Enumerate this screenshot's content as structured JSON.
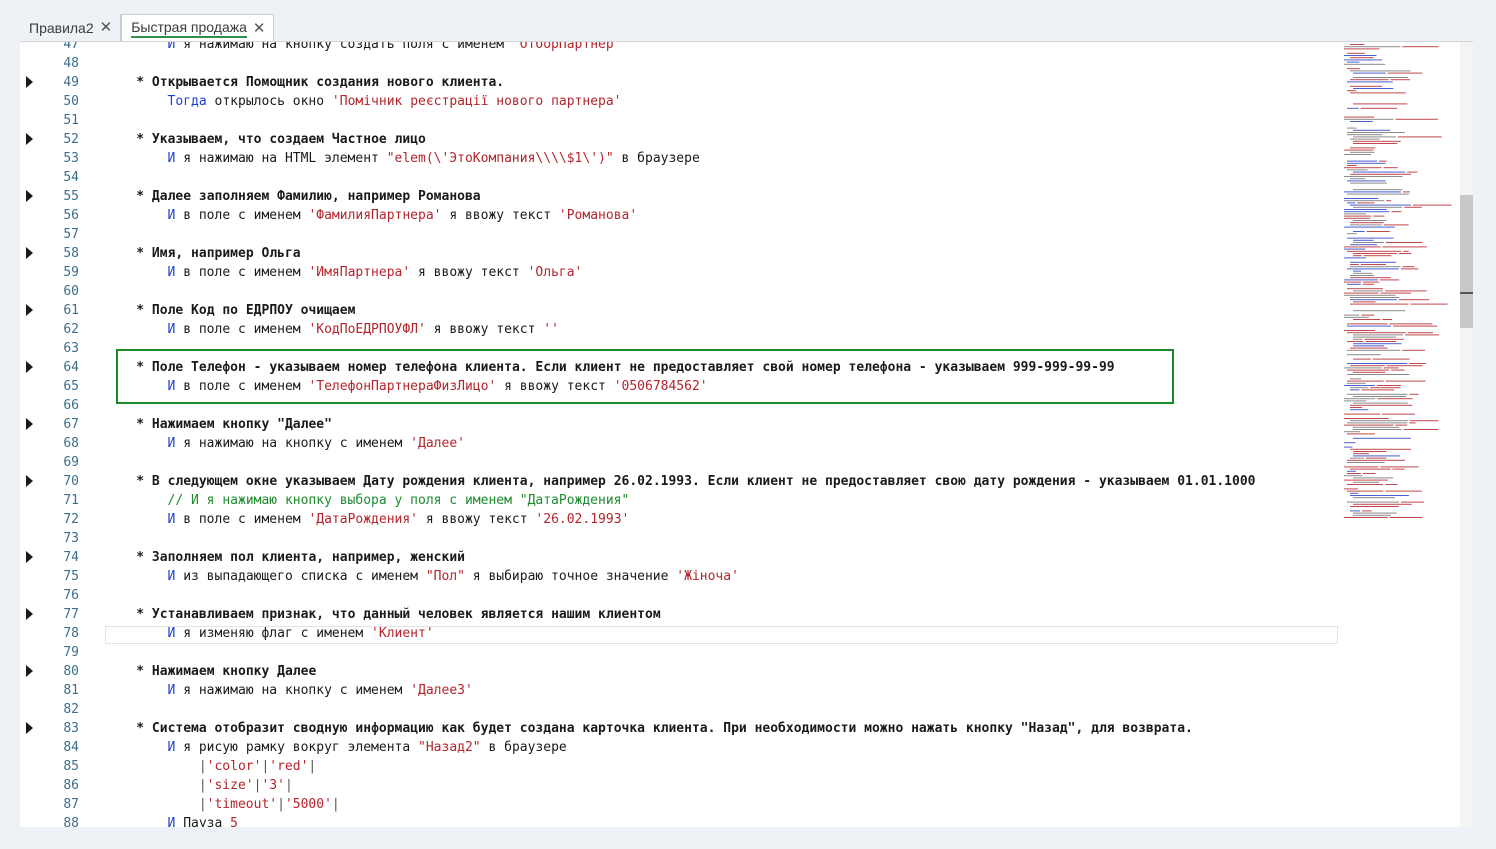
{
  "tabs": [
    {
      "label": "Правила2",
      "active": false
    },
    {
      "label": "Быстрая продажа",
      "active": true
    }
  ],
  "lines": [
    {
      "n": "47",
      "arrow": false,
      "indent": 8,
      "parts": [
        [
          "kw",
          "И"
        ],
        [
          "text",
          " я нажимаю на кнопку создать поля с именем "
        ],
        [
          "str",
          "\"ОтборПартнер\""
        ]
      ]
    },
    {
      "n": "48",
      "arrow": false,
      "indent": 0,
      "parts": []
    },
    {
      "n": "49",
      "arrow": true,
      "indent": 4,
      "parts": [
        [
          "step",
          "* Открывается Помощник создания нового клиента."
        ]
      ]
    },
    {
      "n": "50",
      "arrow": false,
      "indent": 8,
      "parts": [
        [
          "kw",
          "Тогда"
        ],
        [
          "text",
          " открылось окно "
        ],
        [
          "str",
          "'Помічник реєстрації нового партнера'"
        ]
      ]
    },
    {
      "n": "51",
      "arrow": false,
      "indent": 0,
      "parts": []
    },
    {
      "n": "52",
      "arrow": true,
      "indent": 4,
      "parts": [
        [
          "step",
          "* Указываем, что создаем Частное лицо"
        ]
      ]
    },
    {
      "n": "53",
      "arrow": false,
      "indent": 8,
      "parts": [
        [
          "kw",
          "И"
        ],
        [
          "text",
          " я нажимаю на HTML элемент "
        ],
        [
          "str",
          "\"elem(\\'ЭтоКомпания\\\\\\\\$1\\')\""
        ],
        [
          "text",
          " в браузере"
        ]
      ]
    },
    {
      "n": "54",
      "arrow": false,
      "indent": 0,
      "parts": []
    },
    {
      "n": "55",
      "arrow": true,
      "indent": 4,
      "parts": [
        [
          "step",
          "* Далее заполняем Фамилию, например Романова"
        ]
      ]
    },
    {
      "n": "56",
      "arrow": false,
      "indent": 8,
      "parts": [
        [
          "kw",
          "И"
        ],
        [
          "text",
          " в поле с именем "
        ],
        [
          "str",
          "'ФамилияПартнера'"
        ],
        [
          "text",
          " я ввожу текст "
        ],
        [
          "str",
          "'Романова'"
        ]
      ]
    },
    {
      "n": "57",
      "arrow": false,
      "indent": 0,
      "parts": []
    },
    {
      "n": "58",
      "arrow": true,
      "indent": 4,
      "parts": [
        [
          "step",
          "* Имя, например Ольга"
        ]
      ]
    },
    {
      "n": "59",
      "arrow": false,
      "indent": 8,
      "parts": [
        [
          "kw",
          "И"
        ],
        [
          "text",
          " в поле с именем "
        ],
        [
          "str",
          "'ИмяПартнера'"
        ],
        [
          "text",
          " я ввожу текст "
        ],
        [
          "str",
          "'Ольга'"
        ]
      ]
    },
    {
      "n": "60",
      "arrow": false,
      "indent": 0,
      "parts": []
    },
    {
      "n": "61",
      "arrow": true,
      "indent": 4,
      "parts": [
        [
          "step",
          "* Поле Код по ЕДРПОУ очищаем"
        ]
      ]
    },
    {
      "n": "62",
      "arrow": false,
      "indent": 8,
      "parts": [
        [
          "kw",
          "И"
        ],
        [
          "text",
          " в поле с именем "
        ],
        [
          "str",
          "'КодПоЕДРПОУФЛ'"
        ],
        [
          "text",
          " я ввожу текст "
        ],
        [
          "str",
          "''"
        ]
      ]
    },
    {
      "n": "63",
      "arrow": false,
      "indent": 0,
      "parts": []
    },
    {
      "n": "64",
      "arrow": true,
      "indent": 4,
      "parts": [
        [
          "step",
          "* Поле Телефон - указываем номер телефона клиента. Если клиент не предоставляет свой номер телефона - указываем 999-999-99-99"
        ]
      ]
    },
    {
      "n": "65",
      "arrow": false,
      "indent": 8,
      "parts": [
        [
          "kw",
          "И"
        ],
        [
          "text",
          " в поле с именем "
        ],
        [
          "str",
          "'ТелефонПартнераФизЛицо'"
        ],
        [
          "text",
          " я ввожу текст "
        ],
        [
          "str",
          "'0506784562'"
        ]
      ]
    },
    {
      "n": "66",
      "arrow": false,
      "indent": 0,
      "parts": []
    },
    {
      "n": "67",
      "arrow": true,
      "indent": 4,
      "parts": [
        [
          "step",
          "* Нажимаем кнопку \"Далее\""
        ]
      ]
    },
    {
      "n": "68",
      "arrow": false,
      "indent": 8,
      "parts": [
        [
          "kw",
          "И"
        ],
        [
          "text",
          " я нажимаю на кнопку с именем "
        ],
        [
          "str",
          "'Далее'"
        ]
      ]
    },
    {
      "n": "69",
      "arrow": false,
      "indent": 0,
      "parts": []
    },
    {
      "n": "70",
      "arrow": true,
      "indent": 4,
      "parts": [
        [
          "step",
          "* В следующем окне указываем Дату рождения клиента, например 26.02.1993. Если клиент не предоставляет свою дату рождения - указываем 01.01.1000"
        ]
      ]
    },
    {
      "n": "71",
      "arrow": false,
      "indent": 8,
      "parts": [
        [
          "cmt",
          "// И я нажимаю кнопку выбора у поля с именем \"ДатаРождения\""
        ]
      ]
    },
    {
      "n": "72",
      "arrow": false,
      "indent": 8,
      "parts": [
        [
          "kw",
          "И"
        ],
        [
          "text",
          " в поле с именем "
        ],
        [
          "str",
          "'ДатаРождения'"
        ],
        [
          "text",
          " я ввожу текст "
        ],
        [
          "str",
          "'26.02.1993'"
        ]
      ]
    },
    {
      "n": "73",
      "arrow": false,
      "indent": 0,
      "parts": []
    },
    {
      "n": "74",
      "arrow": true,
      "indent": 4,
      "parts": [
        [
          "step",
          "* Заполняем пол клиента, например, женский"
        ]
      ]
    },
    {
      "n": "75",
      "arrow": false,
      "indent": 8,
      "parts": [
        [
          "kw",
          "И"
        ],
        [
          "text",
          " из выпадающего списка с именем "
        ],
        [
          "str",
          "\"Пол\""
        ],
        [
          "text",
          " я выбираю точное значение "
        ],
        [
          "str",
          "'Жіноча'"
        ]
      ]
    },
    {
      "n": "76",
      "arrow": false,
      "indent": 0,
      "parts": []
    },
    {
      "n": "77",
      "arrow": true,
      "indent": 4,
      "parts": [
        [
          "step",
          "* Устанавливаем признак, что данный человек является нашим клиентом"
        ]
      ]
    },
    {
      "n": "78",
      "arrow": false,
      "indent": 8,
      "parts": [
        [
          "kw",
          "И"
        ],
        [
          "text",
          " я изменяю флаг с именем "
        ],
        [
          "str",
          "'Клиент'"
        ]
      ]
    },
    {
      "n": "79",
      "arrow": false,
      "indent": 0,
      "parts": []
    },
    {
      "n": "80",
      "arrow": true,
      "indent": 4,
      "parts": [
        [
          "step",
          "* Нажимаем кнопку Далее"
        ]
      ]
    },
    {
      "n": "81",
      "arrow": false,
      "indent": 8,
      "parts": [
        [
          "kw",
          "И"
        ],
        [
          "text",
          " я нажимаю на кнопку с именем "
        ],
        [
          "str",
          "'Далее3'"
        ]
      ]
    },
    {
      "n": "82",
      "arrow": false,
      "indent": 0,
      "parts": []
    },
    {
      "n": "83",
      "arrow": true,
      "indent": 4,
      "parts": [
        [
          "step",
          "* Система отобразит сводную информацию как будет создана карточка клиента. При необходимости можно нажать кнопку \"Назад\", для возврата."
        ]
      ]
    },
    {
      "n": "84",
      "arrow": false,
      "indent": 8,
      "parts": [
        [
          "kw",
          "И"
        ],
        [
          "text",
          " я рисую рамку вокруг элемента "
        ],
        [
          "str",
          "\"Назад2\""
        ],
        [
          "text",
          " в браузере"
        ]
      ]
    },
    {
      "n": "85",
      "arrow": false,
      "indent": 12,
      "parts": [
        [
          "sep",
          "|"
        ],
        [
          "str",
          "'color'"
        ],
        [
          "sep",
          "|"
        ],
        [
          "str",
          "'red'"
        ],
        [
          "sep",
          "|"
        ]
      ]
    },
    {
      "n": "86",
      "arrow": false,
      "indent": 12,
      "parts": [
        [
          "sep",
          "|"
        ],
        [
          "str",
          "'size'"
        ],
        [
          "sep",
          "|"
        ],
        [
          "str",
          "'3'"
        ],
        [
          "sep",
          "|"
        ]
      ]
    },
    {
      "n": "87",
      "arrow": false,
      "indent": 12,
      "parts": [
        [
          "sep",
          "|"
        ],
        [
          "str",
          "'timeout'"
        ],
        [
          "sep",
          "|"
        ],
        [
          "str",
          "'5000'"
        ],
        [
          "sep",
          "|"
        ]
      ]
    },
    {
      "n": "88",
      "arrow": false,
      "indent": 8,
      "parts": [
        [
          "kw",
          "И"
        ],
        [
          "text",
          " Пауза "
        ],
        [
          "str",
          "5"
        ]
      ]
    }
  ]
}
